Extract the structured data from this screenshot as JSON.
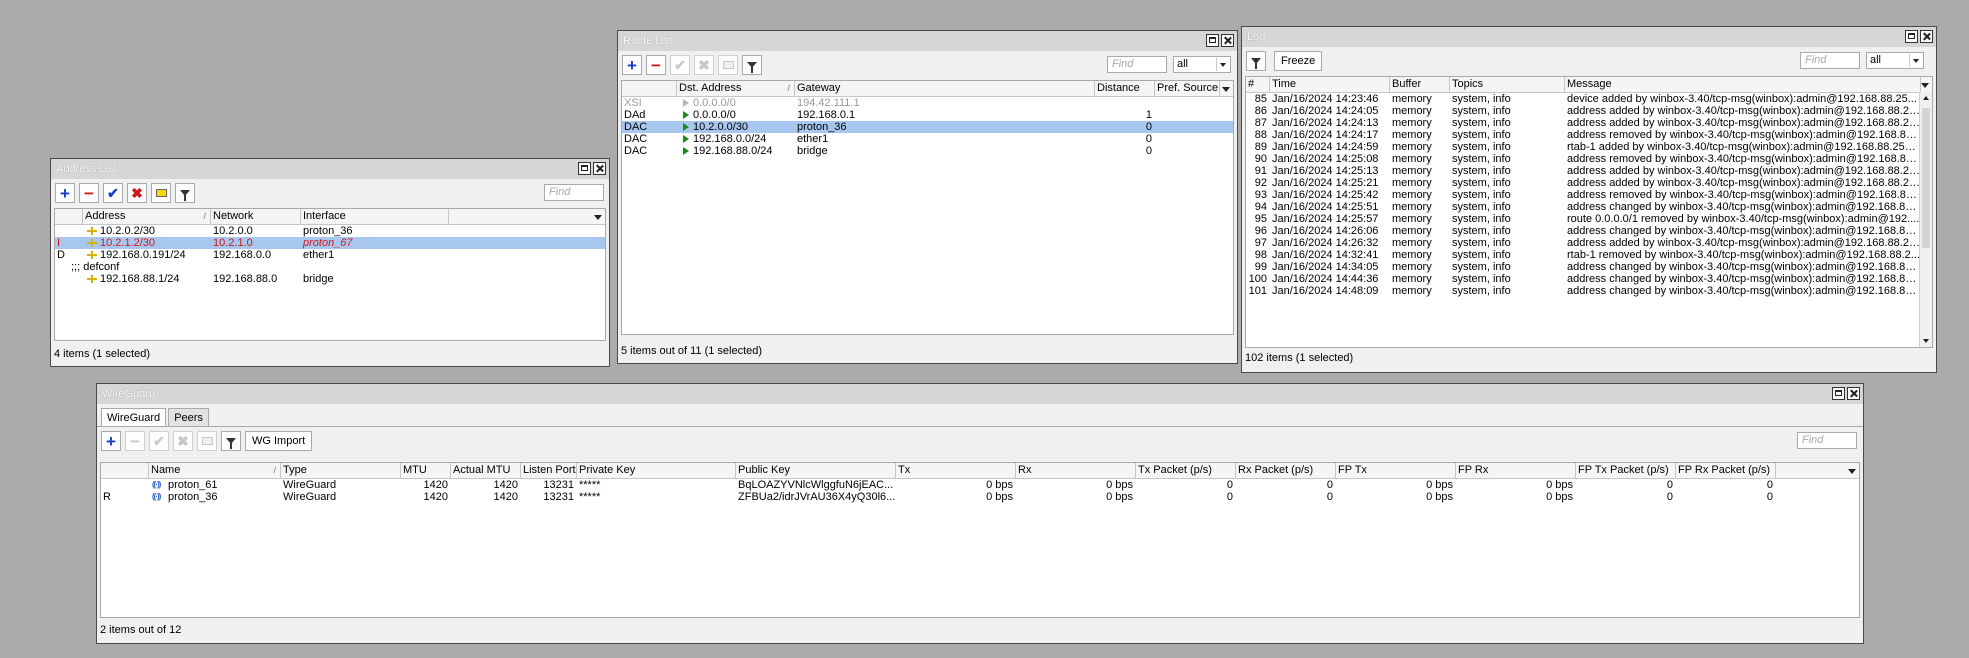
{
  "address_list": {
    "title": "Address List",
    "find_placeholder": "Find",
    "columns": [
      "",
      "Address",
      "Network",
      "Interface"
    ],
    "rows": [
      {
        "flag": "",
        "address": "10.2.0.2/30",
        "network": "10.2.0.0",
        "interface": "proton_36",
        "style": "normal"
      },
      {
        "flag": "I",
        "address": "10.2.1.2/30",
        "network": "10.2.1.0",
        "interface": "proton_67",
        "style": "invalid"
      },
      {
        "flag": "D",
        "address": "192.168.0.191/24",
        "network": "192.168.0.0",
        "interface": "ether1",
        "style": "normal"
      },
      {
        "comment": ";;; defconf"
      },
      {
        "flag": "",
        "address": "192.168.88.1/24",
        "network": "192.168.88.0",
        "interface": "bridge",
        "style": "normal"
      }
    ],
    "status": "4 items (1 selected)"
  },
  "route_list": {
    "title": "Route List",
    "find_placeholder": "Find",
    "filter_value": "all",
    "columns": [
      "",
      "Dst. Address",
      "Gateway",
      "Distance",
      "Pref. Source"
    ],
    "rows": [
      {
        "flag": "XSI",
        "dst": "0.0.0.0/0",
        "gateway": "194.42.111.1",
        "distance": "",
        "pref": "",
        "style": "disabled"
      },
      {
        "flag": "DAd",
        "dst": "0.0.0.0/0",
        "gateway": "192.168.0.1",
        "distance": "1",
        "pref": "",
        "style": "normal"
      },
      {
        "flag": "DAC",
        "dst": "10.2.0.0/30",
        "gateway": "proton_36",
        "distance": "0",
        "pref": "",
        "style": "selected"
      },
      {
        "flag": "DAC",
        "dst": "192.168.0.0/24",
        "gateway": "ether1",
        "distance": "0",
        "pref": "",
        "style": "normal"
      },
      {
        "flag": "DAC",
        "dst": "192.168.88.0/24",
        "gateway": "bridge",
        "distance": "0",
        "pref": "",
        "style": "normal"
      }
    ],
    "status": "5 items out of 11 (1 selected)"
  },
  "log": {
    "title": "Log",
    "freeze_label": "Freeze",
    "find_placeholder": "Find",
    "filter_value": "all",
    "columns": [
      "#",
      "Time",
      "Buffer",
      "Topics",
      "Message"
    ],
    "rows": [
      {
        "n": "85",
        "time": "Jan/16/2024 14:23:46",
        "buffer": "memory",
        "topics": "system, info",
        "message": "device added by winbox-3.40/tcp-msg(winbox):admin@192.168.88.25..."
      },
      {
        "n": "86",
        "time": "Jan/16/2024 14:24:05",
        "buffer": "memory",
        "topics": "system, info",
        "message": "address added by winbox-3.40/tcp-msg(winbox):admin@192.168.88.25..."
      },
      {
        "n": "87",
        "time": "Jan/16/2024 14:24:13",
        "buffer": "memory",
        "topics": "system, info",
        "message": "address added by winbox-3.40/tcp-msg(winbox):admin@192.168.88.25..."
      },
      {
        "n": "88",
        "time": "Jan/16/2024 14:24:17",
        "buffer": "memory",
        "topics": "system, info",
        "message": "address removed by winbox-3.40/tcp-msg(winbox):admin@192.168.88...."
      },
      {
        "n": "89",
        "time": "Jan/16/2024 14:24:59",
        "buffer": "memory",
        "topics": "system, info",
        "message": "rtab-1 added by winbox-3.40/tcp-msg(winbox):admin@192.168.88.254 ..."
      },
      {
        "n": "90",
        "time": "Jan/16/2024 14:25:08",
        "buffer": "memory",
        "topics": "system, info",
        "message": "address removed by winbox-3.40/tcp-msg(winbox):admin@192.168.88...."
      },
      {
        "n": "91",
        "time": "Jan/16/2024 14:25:13",
        "buffer": "memory",
        "topics": "system, info",
        "message": "address added by winbox-3.40/tcp-msg(winbox):admin@192.168.88.25..."
      },
      {
        "n": "92",
        "time": "Jan/16/2024 14:25:21",
        "buffer": "memory",
        "topics": "system, info",
        "message": "address added by winbox-3.40/tcp-msg(winbox):admin@192.168.88.25..."
      },
      {
        "n": "93",
        "time": "Jan/16/2024 14:25:42",
        "buffer": "memory",
        "topics": "system, info",
        "message": "address removed by winbox-3.40/tcp-msg(winbox):admin@192.168.88...."
      },
      {
        "n": "94",
        "time": "Jan/16/2024 14:25:51",
        "buffer": "memory",
        "topics": "system, info",
        "message": "address changed by winbox-3.40/tcp-msg(winbox):admin@192.168.88...."
      },
      {
        "n": "95",
        "time": "Jan/16/2024 14:25:57",
        "buffer": "memory",
        "topics": "system, info",
        "message": "route 0.0.0.0/1 removed by winbox-3.40/tcp-msg(winbox):admin@192...."
      },
      {
        "n": "96",
        "time": "Jan/16/2024 14:26:06",
        "buffer": "memory",
        "topics": "system, info",
        "message": "address changed by winbox-3.40/tcp-msg(winbox):admin@192.168.88...."
      },
      {
        "n": "97",
        "time": "Jan/16/2024 14:26:32",
        "buffer": "memory",
        "topics": "system, info",
        "message": "address added by winbox-3.40/tcp-msg(winbox):admin@192.168.88.25..."
      },
      {
        "n": "98",
        "time": "Jan/16/2024 14:32:41",
        "buffer": "memory",
        "topics": "system, info",
        "message": "rtab-1 removed by winbox-3.40/tcp-msg(winbox):admin@192.168.88.2..."
      },
      {
        "n": "99",
        "time": "Jan/16/2024 14:34:05",
        "buffer": "memory",
        "topics": "system, info",
        "message": "address changed by winbox-3.40/tcp-msg(winbox):admin@192.168.88...."
      },
      {
        "n": "100",
        "time": "Jan/16/2024 14:44:36",
        "buffer": "memory",
        "topics": "system, info",
        "message": "address changed by winbox-3.40/tcp-msg(winbox):admin@192.168.88...."
      },
      {
        "n": "101",
        "time": "Jan/16/2024 14:48:09",
        "buffer": "memory",
        "topics": "system, info",
        "message": "address changed by winbox-3.40/tcp-msg(winbox):admin@192.168.88...."
      }
    ],
    "status": "102 items (1 selected)"
  },
  "wireguard": {
    "title": "WireGuard",
    "tabs": [
      "WireGuard",
      "Peers"
    ],
    "import_label": "WG Import",
    "find_placeholder": "Find",
    "columns": [
      "",
      "Name",
      "Type",
      "MTU",
      "Actual MTU",
      "Listen Port",
      "Private Key",
      "Public Key",
      "Tx",
      "Rx",
      "Tx Packet (p/s)",
      "Rx Packet (p/s)",
      "FP Tx",
      "FP Rx",
      "FP Tx Packet (p/s)",
      "FP Rx Packet (p/s)"
    ],
    "rows": [
      {
        "flag": "",
        "name": "proton_61",
        "type": "WireGuard",
        "mtu": "1420",
        "actual_mtu": "1420",
        "port": "13231",
        "private_key": "*****",
        "public_key": "BqLOAZYVNlcWlggfuN6jEAC...",
        "tx": "0 bps",
        "rx": "0 bps",
        "txp": "0",
        "rxp": "0",
        "fptx": "0 bps",
        "fprx": "0 bps",
        "fptxp": "0",
        "fprxp": "0"
      },
      {
        "flag": "R",
        "name": "proton_36",
        "type": "WireGuard",
        "mtu": "1420",
        "actual_mtu": "1420",
        "port": "13231",
        "private_key": "*****",
        "public_key": "ZFBUa2/idrJVrAU36X4yQ30l6...",
        "tx": "0 bps",
        "rx": "0 bps",
        "txp": "0",
        "rxp": "0",
        "fptx": "0 bps",
        "fprx": "0 bps",
        "fptxp": "0",
        "fprxp": "0"
      }
    ],
    "status": "2 items out of 12"
  }
}
